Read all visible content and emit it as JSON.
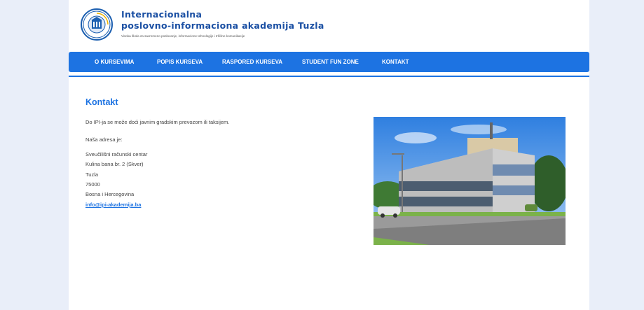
{
  "brand": {
    "title_line1": "Internacionalna",
    "title_line2": "poslovno-informaciona akademija Tuzla",
    "subtitle": "Visoka škola za savremeno poslovanje, informacione tehnologije i tržišne komunikacije",
    "seal_text": "INTERNACIONALNA POSLOVNO-INFORMACIONA AKADEMIJA TUZLA",
    "seal_letters": "IPI"
  },
  "nav": {
    "items": [
      {
        "label": "O KURSEVIMA"
      },
      {
        "label": "POPIS KURSEVA"
      },
      {
        "label": "RASPORED KURSEVA"
      },
      {
        "label": "STUDENT FUN ZONE"
      },
      {
        "label": "KONTAKT"
      }
    ]
  },
  "content": {
    "title": "Kontakt",
    "intro": "Do IPI-ja se može doći javnim gradskim prevozom ili taksijem.",
    "address_heading": "Naša adresa je:",
    "address": [
      "Sveučilišni računski centar",
      "Kulina bana br. 2 (Skver)",
      "Tuzla",
      "75000",
      "Bosna i Hercegovina"
    ],
    "email": "info@ipi-akademija.ba"
  },
  "colors": {
    "accent": "#1d73e2",
    "page_background": "#e9eef9",
    "brand_text": "#1a4fa3"
  },
  "photo": {
    "subject": "building-photo"
  }
}
